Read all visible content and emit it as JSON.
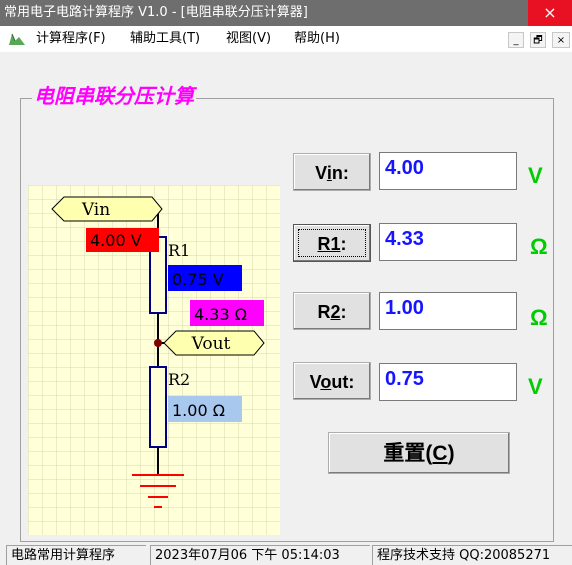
{
  "window": {
    "title": "常用电子电路计算程序  V1.0 - [电阻串联分压计算器]",
    "close_glyph": "×"
  },
  "menu": {
    "items": [
      "计算程序(F)",
      "辅助工具(T)",
      "视图(V)",
      "帮助(H)"
    ],
    "mdi_buttons": [
      "_",
      "🗗",
      "×"
    ]
  },
  "panel": {
    "title": "电阻串联分压计算"
  },
  "schematic": {
    "vin_tag": "Vin",
    "vin_value": "4.00 V",
    "r1_name": "R1",
    "r1_voltage": "0.75 V",
    "r1_resistance": "4.33 Ω",
    "vout_tag": "Vout",
    "r2_name": "R2",
    "r2_resistance": "1.00 Ω"
  },
  "form": {
    "rows": [
      {
        "label_pre": "V",
        "label_ul": "i",
        "label_post": "n:",
        "value": "4.00",
        "unit": "V"
      },
      {
        "label_pre": "",
        "label_ul": "R1",
        "label_post": ":",
        "value": "4.33",
        "unit": "Ω"
      },
      {
        "label_pre": "R",
        "label_ul": "2",
        "label_post": ":",
        "value": "1.00",
        "unit": "Ω"
      },
      {
        "label_pre": "V",
        "label_ul": "o",
        "label_post": "ut:",
        "value": "0.75",
        "unit": "V"
      }
    ],
    "reset_pre": "重置(",
    "reset_ul": "C",
    "reset_post": ")"
  },
  "statusbar": {
    "segments": [
      "电路常用计算程序",
      "2023年07月06 下午 05:14:03",
      "程序技术支持 QQ:20085271"
    ]
  },
  "colors": {
    "title_magenta": "#ff00ff",
    "value_blue": "#1515ff",
    "unit_green": "#00cc00",
    "vin_red": "#ff0000",
    "r1v_blue": "#0000ff",
    "r1_magenta": "#ff00ff",
    "r2_lightblue": "#a8c8ee",
    "tag_yellow": "#ffffb0",
    "grid_bg": "#ffffd8"
  }
}
